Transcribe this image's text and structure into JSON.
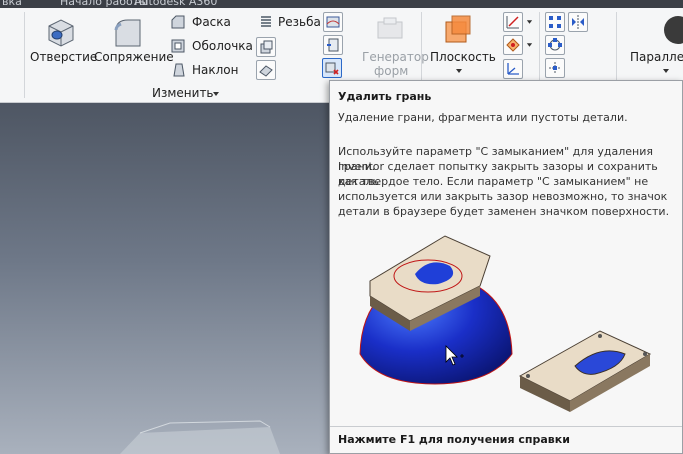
{
  "top_tabs": [
    "вка",
    "Начало работы",
    "Autodesk A360"
  ],
  "ribbon": {
    "hole_label": "Отверстие",
    "fillet_label": "Сопряжение",
    "chamfer_label": "Фаска",
    "shell_label": "Оболочка",
    "draft_label": "Наклон",
    "thread_label": "Резьба",
    "generator_label_line1": "Генератор",
    "generator_label_line2": "форм",
    "plane_label": "Плоскость",
    "parallel_label": "Параллел",
    "modify_panel_label": "Изменить"
  },
  "tooltip": {
    "title": "Удалить грань",
    "description": "Удаление грани, фрагмента или пустоты детали.",
    "body_lines": [
      "Используйте параметр \"С замыканием\" для удаления грани.",
      "Inventor сделает попытку закрыть зазоры и сохранить деталь",
      "как твердое тело. Если параметр \"С замыканием\" не",
      "используется или закрыть зазор невозможно, то значок",
      "детали в браузере будет заменен значком поверхности."
    ],
    "footer": "Нажмите F1 для получения справки"
  }
}
